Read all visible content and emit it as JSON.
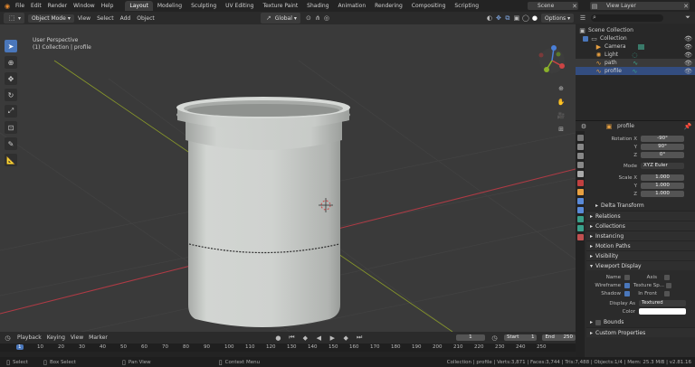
{
  "topbar": {
    "menus": [
      "File",
      "Edit",
      "Render",
      "Window",
      "Help"
    ],
    "workspaces": [
      "Layout",
      "Modeling",
      "Sculpting",
      "UV Editing",
      "Texture Paint",
      "Shading",
      "Animation",
      "Rendering",
      "Compositing",
      "Scripting"
    ],
    "scene": "Scene",
    "view_layer": "View Layer"
  },
  "header": {
    "mode": "Object Mode",
    "menus": [
      "View",
      "Select",
      "Add",
      "Object"
    ],
    "transform": "Global",
    "options": "Options"
  },
  "viewport": {
    "view_name": "User Perspective",
    "context": "(1) Collection | profile"
  },
  "outliner": {
    "root": "Scene Collection",
    "collection": "Collection",
    "items": [
      "Camera",
      "Light",
      "path",
      "profile"
    ]
  },
  "properties": {
    "object_name": "profile",
    "rotation_label": "Rotation X",
    "rotation": [
      "-90°",
      "90°",
      "0°"
    ],
    "mode_label": "Mode",
    "mode": "XYZ Euler",
    "scale_label": "Scale X",
    "scale": [
      "1.000",
      "1.000",
      "1.000"
    ],
    "axis_y": "Y",
    "axis_z": "Z",
    "sections": [
      "Delta Transform",
      "Relations",
      "Collections",
      "Instancing",
      "Motion Paths",
      "Visibility",
      "Viewport Display"
    ],
    "vd": {
      "name": "Name",
      "axis": "Axis",
      "wireframe": "Wireframe",
      "texture_space": "Texture Sp...",
      "shadow": "Shadow",
      "in_front": "In Front",
      "display_as": "Display As",
      "display_value": "Textured",
      "color": "Color",
      "bounds": "Bounds",
      "custom_props": "Custom Properties"
    }
  },
  "timeline": {
    "menus": [
      "Playback",
      "Keying",
      "View",
      "Marker"
    ],
    "current_frame": "1",
    "start_label": "Start",
    "start": "1",
    "end_label": "End",
    "end": "250",
    "ticks": [
      "1",
      "10",
      "20",
      "30",
      "40",
      "50",
      "60",
      "70",
      "80",
      "90",
      "100",
      "110",
      "120",
      "130",
      "140",
      "150",
      "160",
      "170",
      "180",
      "190",
      "200",
      "210",
      "220",
      "230",
      "240",
      "250"
    ]
  },
  "status": {
    "select": "Select",
    "box_select": "Box Select",
    "pan_view": "Pan View",
    "context_menu": "Context Menu",
    "info": "Collection | profile | Verts:3,871 | Faces:3,744 | Tris:7,488 | Objects:1/4 | Mem: 25.3 MiB | v2.81.16"
  },
  "colors": {
    "accent": "#4a77bb",
    "viewport_bg": "#3a3a3a",
    "object": "#c8cbc8",
    "x_axis": "#b03a45",
    "y_axis": "#8a9a2a"
  }
}
